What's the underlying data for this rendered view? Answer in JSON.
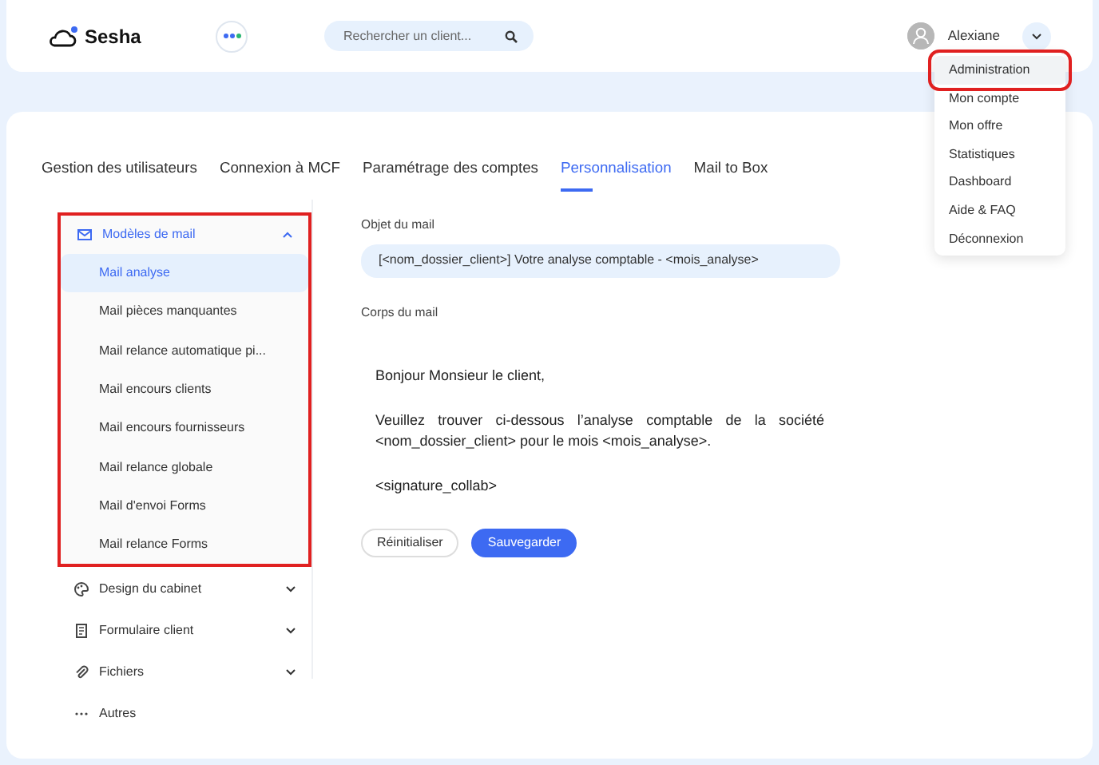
{
  "header": {
    "logo": "Sesha",
    "search": {
      "placeholder": "Rechercher un client..."
    },
    "user": "Alexiane"
  },
  "user_menu": {
    "expanded": true,
    "items": [
      {
        "label": "Administration",
        "selected": true,
        "highlighted": true
      },
      {
        "label": "Mon compte",
        "selected": false,
        "highlighted": false
      },
      {
        "label": "Mon offre",
        "selected": false,
        "highlighted": false
      },
      {
        "label": "Statistiques",
        "selected": false,
        "highlighted": false
      },
      {
        "label": "Dashboard",
        "selected": false,
        "highlighted": false
      },
      {
        "label": "Aide & FAQ",
        "selected": false,
        "highlighted": false
      },
      {
        "label": "Déconnexion",
        "selected": false,
        "highlighted": false
      }
    ]
  },
  "tabs": [
    {
      "label": "Gestion des utilisateurs",
      "selected": false
    },
    {
      "label": "Connexion à MCF",
      "selected": false
    },
    {
      "label": "Paramétrage des comptes",
      "selected": false
    },
    {
      "label": "Personnalisation",
      "selected": true
    },
    {
      "label": "Mail to Box",
      "selected": false
    }
  ],
  "sidebar": {
    "items": [
      {
        "label": "Modèles de mail",
        "kind": "mail",
        "expanded": true,
        "highlighted": true,
        "children": [
          {
            "label": "Mail analyse",
            "selected": true
          },
          {
            "label": "Mail pièces manquantes",
            "selected": false
          },
          {
            "label": "Mail relance automatique pi...",
            "selected": false
          },
          {
            "label": "Mail encours clients",
            "selected": false
          },
          {
            "label": "Mail encours fournisseurs",
            "selected": false
          },
          {
            "label": "Mail relance globale",
            "selected": false
          },
          {
            "label": "Mail d'envoi Forms",
            "selected": false
          },
          {
            "label": "Mail relance Forms",
            "selected": false
          }
        ]
      },
      {
        "label": "Design du cabinet",
        "kind": "palette",
        "expanded": false,
        "highlighted": false
      },
      {
        "label": "Formulaire client",
        "kind": "form",
        "expanded": false,
        "highlighted": false
      },
      {
        "label": "Fichiers",
        "kind": "clip",
        "expanded": false,
        "highlighted": false
      },
      {
        "label": "Autres",
        "kind": "dots",
        "highlighted": false
      }
    ]
  },
  "editor": {
    "subject_label": "Objet du mail",
    "subject": "[<nom_dossier_client>] Votre analyse comptable - <mois_analyse>",
    "body_label": "Corps du mail",
    "body": [
      "Bonjour Monsieur le client,",
      "Veuillez trouver ci-dessous l’analyse comptable de la société <nom_dossier_client> pour le mois <mois_analyse>.",
      "<signature_collab>"
    ],
    "buttons": [
      {
        "label": "Réinitialiser",
        "kind": "secondary"
      },
      {
        "label": "Sauvegarder",
        "kind": "primary"
      }
    ]
  }
}
